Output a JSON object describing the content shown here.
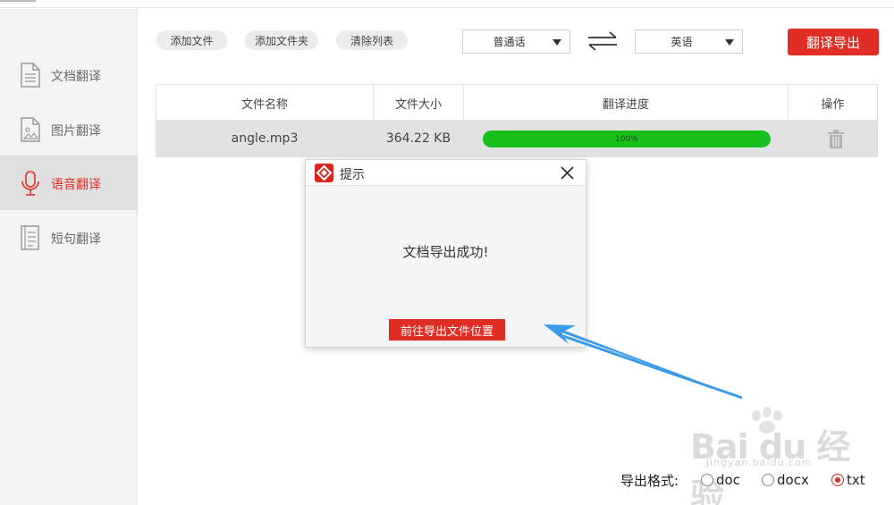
{
  "sidebar": {
    "items": [
      {
        "label": "文档翻译",
        "icon": "document-icon",
        "active": false
      },
      {
        "label": "图片翻译",
        "icon": "image-icon",
        "active": false
      },
      {
        "label": "语音翻译",
        "icon": "microphone-icon",
        "active": true
      },
      {
        "label": "短句翻译",
        "icon": "text-lines-icon",
        "active": false
      }
    ]
  },
  "toolbar": {
    "add_file": "添加文件",
    "add_folder": "添加文件夹",
    "clear_list": "清除列表",
    "source_lang": "普通话",
    "target_lang": "英语",
    "swap_icon": "swap-arrows-icon",
    "translate_export": "翻译导出"
  },
  "table": {
    "headers": [
      "文件名称",
      "文件大小",
      "翻译进度",
      "操作"
    ],
    "rows": [
      {
        "name": "angle.mp3",
        "size": "364.22 KB",
        "progress_label": "100%",
        "progress": 1.0,
        "action_icon": "trash-icon"
      }
    ]
  },
  "dialog": {
    "title": "提示",
    "message": "文档导出成功!",
    "button": "前往导出文件位置"
  },
  "export": {
    "label": "导出格式:",
    "options": [
      "doc",
      "docx",
      "txt"
    ],
    "selected": "txt"
  },
  "watermark": {
    "brand": "Bai du 经验",
    "url": "jingyan.baidu.com"
  },
  "colors": {
    "accent": "#e02e24",
    "progress": "#18c01b",
    "annotation_arrow": "#3a9be8"
  }
}
